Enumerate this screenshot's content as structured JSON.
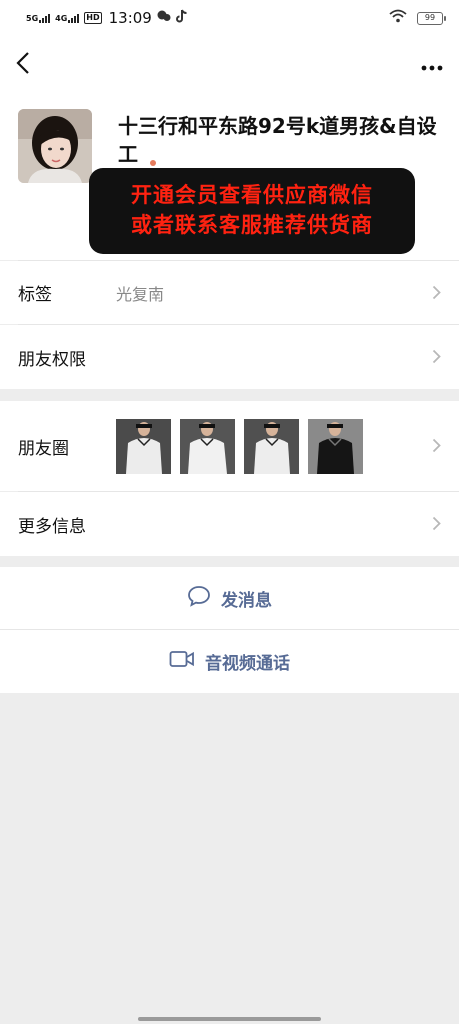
{
  "status_bar": {
    "signal1": "5G",
    "signal2": "4G",
    "hd_badge": "HD",
    "time": "13:09",
    "battery": "99"
  },
  "navbar": {
    "back_icon": "chevron-left-icon",
    "more_icon": "more-dots-icon"
  },
  "profile": {
    "name": "十三行和平东路92号k道男孩&自设工",
    "gender_icon": "female-person-icon",
    "banner_line1": "开通会员查看供应商微信",
    "banner_line2": "或者联系客服推荐供货商",
    "banner_text_color": "#ff2211"
  },
  "rows": {
    "tags_label": "标签",
    "tags_value": "光复南",
    "permissions_label": "朋友权限",
    "moments_label": "朋友圈",
    "more_info_label": "更多信息"
  },
  "actions": {
    "message_label": "发消息",
    "message_icon": "chat-bubble-icon",
    "video_call_label": "音视频通话",
    "video_call_icon": "video-camera-icon",
    "accent_color": "#576b95"
  }
}
